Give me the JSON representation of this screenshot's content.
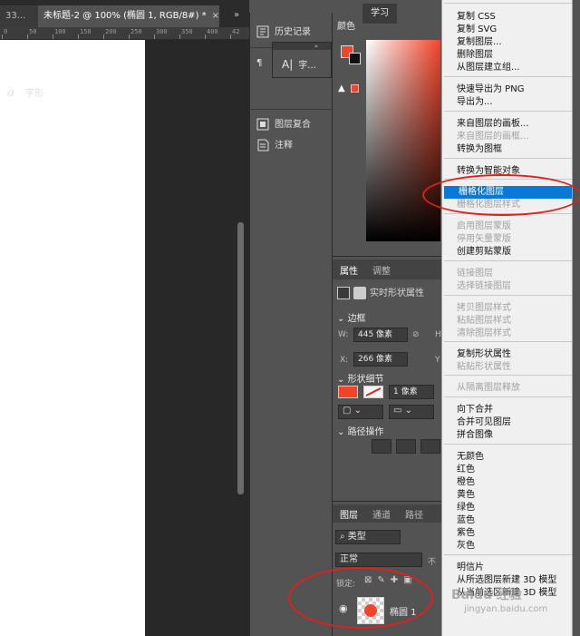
{
  "tabs": {
    "prev": "33...",
    "active": "未标题-2 @ 100% (椭圆 1, RGB/8#) *",
    "close": "×",
    "overflow": "»"
  },
  "ruler": {
    "labels": [
      "0",
      "50",
      "100",
      "150",
      "200",
      "250",
      "300",
      "350",
      "400",
      "42"
    ]
  },
  "collapsed_panels": {
    "history": "历史记录",
    "char_float_label": "字...",
    "glyphs": "字形",
    "layer_comps": "图层复合",
    "notes": "注释",
    "float_close": "»"
  },
  "color_panel": {
    "tab": "颜色",
    "learn_tab": "学习",
    "fg_color": "#f0452b",
    "bg_color": "#111111",
    "warn": "▲"
  },
  "properties": {
    "tab_props": "属性",
    "tab_adjust": "调整",
    "type_label": "实时形状属性",
    "bbox_section": "边框",
    "w_label": "W:",
    "w_value": "445 像素",
    "x_label": "X:",
    "x_value": "266 像素",
    "h_partial": "H",
    "y_partial": "Y",
    "shape_detail": "形状细节",
    "stroke_width": "1 像素",
    "path_ops": "路径操作",
    "fill_color": "#f0452b"
  },
  "layers": {
    "tab_layers": "图层",
    "tab_channels": "通道",
    "tab_paths": "路径",
    "filter_label": "类型",
    "blend_mode": "正常",
    "opacity_partial": "不",
    "lock_label": "锁定:",
    "layer_name": "椭圆 1"
  },
  "menu": {
    "items": [
      {
        "label": "复制 CSS",
        "state": "normal"
      },
      {
        "label": "复制 SVG",
        "state": "normal"
      },
      {
        "label": "复制图层...",
        "state": "normal"
      },
      {
        "label": "删除图层",
        "state": "normal"
      },
      {
        "label": "从图层建立组...",
        "state": "normal"
      },
      {
        "label": "快速导出为 PNG",
        "state": "normal"
      },
      {
        "label": "导出为...",
        "state": "normal"
      },
      {
        "label": "来自图层的画板...",
        "state": "normal"
      },
      {
        "label": "来自图层的画框...",
        "state": "disabled"
      },
      {
        "label": "转换为图框",
        "state": "normal"
      },
      {
        "label": "转换为智能对象",
        "state": "normal"
      },
      {
        "label": "栅格化图层",
        "state": "active"
      },
      {
        "label": "栅格化图层样式",
        "state": "disabled"
      },
      {
        "label": "启用图层蒙版",
        "state": "disabled"
      },
      {
        "label": "停用矢量蒙版",
        "state": "disabled"
      },
      {
        "label": "创建剪贴蒙版",
        "state": "normal"
      },
      {
        "label": "链接图层",
        "state": "disabled"
      },
      {
        "label": "选择链接图层",
        "state": "disabled"
      },
      {
        "label": "拷贝图层样式",
        "state": "disabled"
      },
      {
        "label": "粘贴图层样式",
        "state": "disabled"
      },
      {
        "label": "清除图层样式",
        "state": "disabled"
      },
      {
        "label": "复制形状属性",
        "state": "normal"
      },
      {
        "label": "粘贴形状属性",
        "state": "disabled"
      },
      {
        "label": "从隔离图层释放",
        "state": "disabled"
      },
      {
        "label": "向下合并",
        "state": "normal"
      },
      {
        "label": "合并可见图层",
        "state": "normal"
      },
      {
        "label": "拼合图像",
        "state": "normal"
      },
      {
        "label": "无颜色",
        "state": "normal"
      },
      {
        "label": "红色",
        "state": "normal"
      },
      {
        "label": "橙色",
        "state": "normal"
      },
      {
        "label": "黄色",
        "state": "normal"
      },
      {
        "label": "绿色",
        "state": "normal"
      },
      {
        "label": "蓝色",
        "state": "normal"
      },
      {
        "label": "紫色",
        "state": "normal"
      },
      {
        "label": "灰色",
        "state": "normal"
      },
      {
        "label": "明信片",
        "state": "normal"
      },
      {
        "label": "从所选图层新建 3D 模型",
        "state": "normal"
      },
      {
        "label": "从当前选区新建 3D 模型",
        "state": "normal"
      }
    ]
  },
  "watermark": {
    "logo": "Baidu 经验",
    "url": "jingyan.baidu.com"
  },
  "colors": {
    "accent_red": "#e0201b",
    "menu_highlight": "#0a78d7"
  }
}
